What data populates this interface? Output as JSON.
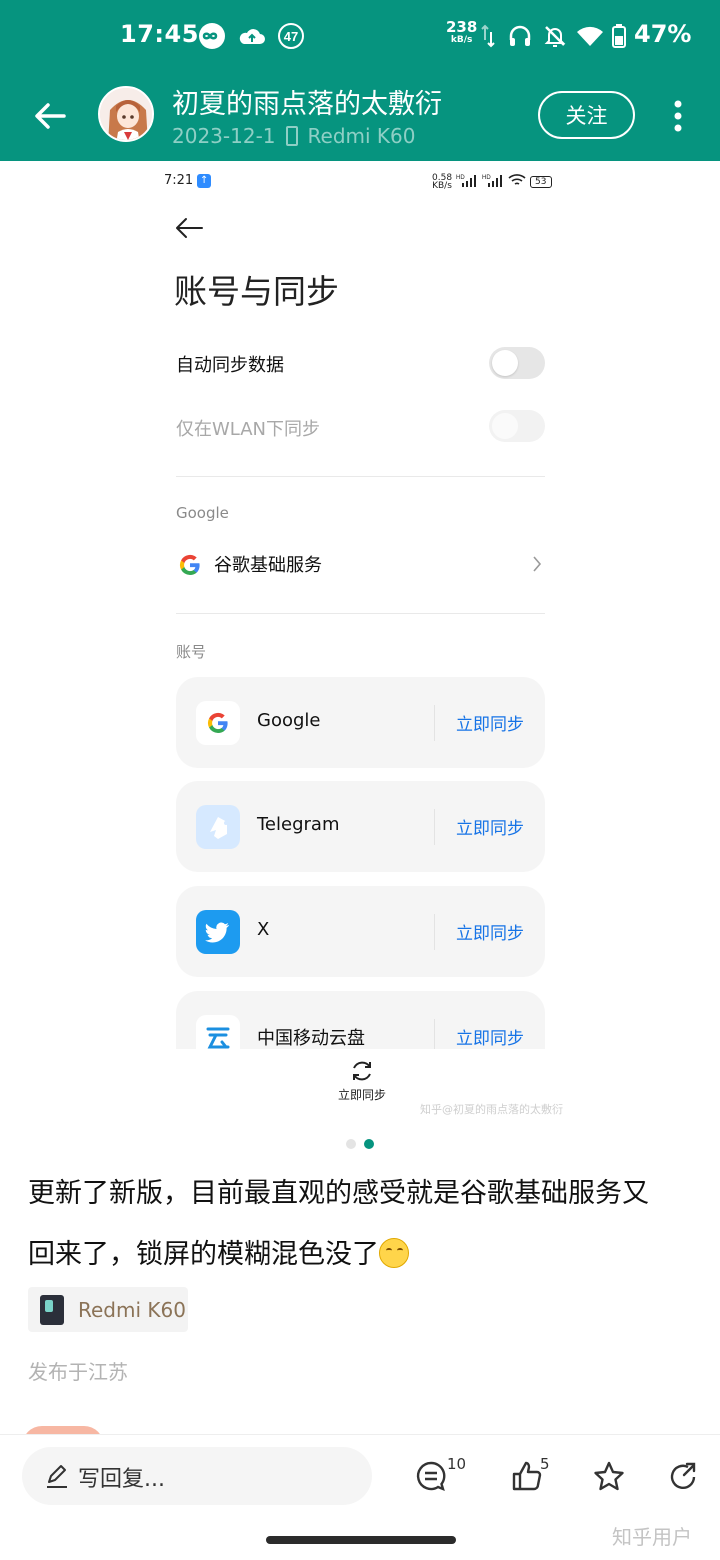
{
  "status_bar": {
    "time": "17:45",
    "notification_badge": "47",
    "net_speed": "238",
    "net_unit": "kB/s",
    "battery": "47%"
  },
  "header": {
    "author": "初夏的雨点落的太敷衍",
    "date": "2023-12-1",
    "device": "Redmi K60",
    "follow_label": "关注",
    "accent_color": "#06947F"
  },
  "screenshot": {
    "time": "7:21",
    "net_speed": "0.58",
    "net_unit": "KB/s",
    "signal_tag_1": "HD",
    "signal_tag_2": "HD",
    "battery": "53",
    "title": "账号与同步",
    "auto_sync_label": "自动同步数据",
    "wlan_only_label": "仅在WLAN下同步",
    "google_section": "Google",
    "google_services_label": "谷歌基础服务",
    "accounts_section": "账号",
    "accounts": [
      {
        "name": "Google",
        "action": "立即同步",
        "icon": "google-icon"
      },
      {
        "name": "Telegram",
        "action": "立即同步",
        "icon": "telegram-icon"
      },
      {
        "name": "X",
        "action": "立即同步",
        "icon": "twitter-icon"
      },
      {
        "name": "中国移动云盘",
        "action": "立即同步",
        "icon": "cloud-drive-icon"
      }
    ],
    "sync_now_label": "立即同步",
    "watermark": "知乎@初夏的雨点落的太敷衍",
    "link_color": "#1673e6"
  },
  "post": {
    "text_line1": "更新了新版，目前最直观的感受就是谷歌基础服务又",
    "text_line2": "回来了，锁屏的模糊混色没了",
    "device_tag": "Redmi K60",
    "location": "发布于江苏"
  },
  "bottom_bar": {
    "reply_placeholder": "写回复...",
    "comment_count": "10",
    "like_count": "5",
    "watermark": "知乎用户"
  }
}
